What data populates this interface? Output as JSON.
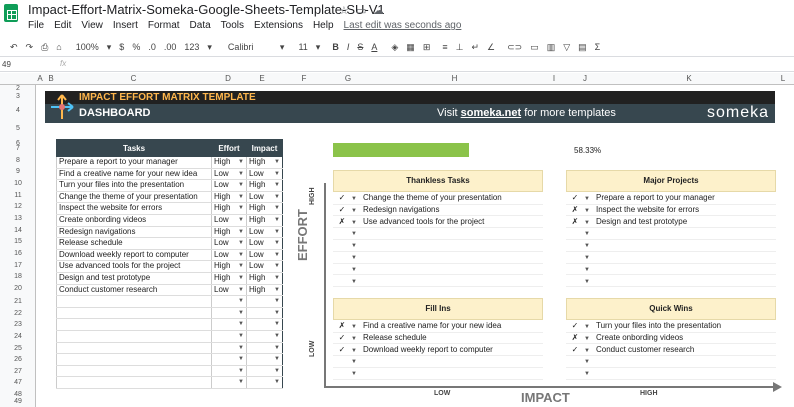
{
  "app": {
    "doc_title": "Impact-Effort-Matrix-Someka-Google-Sheets-Template-SU-V1",
    "menu": [
      "File",
      "Edit",
      "View",
      "Insert",
      "Format",
      "Data",
      "Tools",
      "Extensions",
      "Help"
    ],
    "last_edit": "Last edit was seconds ago"
  },
  "toolbar": {
    "zoom": "100%",
    "currency": "$",
    "percent": "%",
    "dec_less": ".0",
    "dec_more": ".00",
    "num_format": "123",
    "font": "Calibri",
    "font_size": "11",
    "bold": "B",
    "italic": "I",
    "strike": "S",
    "text_color": "A"
  },
  "formula_bar": {
    "cell_ref": "49",
    "fx": "fx"
  },
  "columns": [
    "A",
    "B",
    "C",
    "D",
    "E",
    "F",
    "G",
    "H",
    "I",
    "J",
    "K",
    "L"
  ],
  "rows": [
    "1",
    "2",
    "3",
    "4",
    "5",
    "6",
    "7",
    "8",
    "9",
    "10",
    "11",
    "12",
    "13",
    "14",
    "15",
    "16",
    "17",
    "18",
    "20",
    "21",
    "22",
    "23",
    "24",
    "25",
    "26",
    "27",
    "47",
    "48",
    "49"
  ],
  "header": {
    "template_title": "IMPACT EFFORT MATRIX TEMPLATE",
    "dashboard": "DASHBOARD",
    "visit_prefix": "Visit ",
    "visit_link": "someka.net",
    "visit_suffix": " for more templates",
    "brand": "someka"
  },
  "table": {
    "headers": [
      "Tasks",
      "Effort",
      "Impact"
    ],
    "rows": [
      {
        "task": "Prepare a report to your manager",
        "effort": "High",
        "impact": "High"
      },
      {
        "task": "Find a creative name for your new idea",
        "effort": "Low",
        "impact": "Low"
      },
      {
        "task": "Turn your files into the presentation",
        "effort": "Low",
        "impact": "High"
      },
      {
        "task": "Change the theme of your presentation",
        "effort": "High",
        "impact": "Low"
      },
      {
        "task": "Inspect the website for errors",
        "effort": "High",
        "impact": "High"
      },
      {
        "task": "Create onbording videos",
        "effort": "Low",
        "impact": "High"
      },
      {
        "task": "Redesign navigations",
        "effort": "High",
        "impact": "Low"
      },
      {
        "task": "Release schedule",
        "effort": "Low",
        "impact": "Low"
      },
      {
        "task": "Download weekly report to computer",
        "effort": "Low",
        "impact": "Low"
      },
      {
        "task": "Use advanced tools for the project",
        "effort": "High",
        "impact": "Low"
      },
      {
        "task": "Design and test prototype",
        "effort": "High",
        "impact": "High"
      },
      {
        "task": "Conduct customer research",
        "effort": "Low",
        "impact": "High"
      },
      {
        "task": "",
        "effort": "",
        "impact": ""
      },
      {
        "task": "",
        "effort": "",
        "impact": ""
      },
      {
        "task": "",
        "effort": "",
        "impact": ""
      },
      {
        "task": "",
        "effort": "",
        "impact": ""
      },
      {
        "task": "",
        "effort": "",
        "impact": ""
      },
      {
        "task": "",
        "effort": "",
        "impact": ""
      },
      {
        "task": "",
        "effort": "",
        "impact": ""
      },
      {
        "task": "",
        "effort": "",
        "impact": ""
      }
    ]
  },
  "progress": {
    "fraction": 0.5833,
    "label": "58.33%",
    "color": "#8bc34a"
  },
  "matrix": {
    "effort_label": "EFFORT",
    "impact_label": "IMPACT",
    "high_y": "HIGH",
    "low_y": "LOW",
    "low_x": "LOW",
    "high_x": "HIGH",
    "quadrants": {
      "thankless": {
        "title": "Thankless Tasks",
        "items": [
          {
            "mark": "✓",
            "text": "Change the theme of your presentation"
          },
          {
            "mark": "✓",
            "text": "Redesign navigations"
          },
          {
            "mark": "✗",
            "text": "Use advanced tools for the project"
          },
          {
            "mark": "",
            "text": ""
          },
          {
            "mark": "",
            "text": ""
          },
          {
            "mark": "",
            "text": ""
          },
          {
            "mark": "",
            "text": ""
          },
          {
            "mark": "",
            "text": ""
          }
        ]
      },
      "major": {
        "title": "Major Projects",
        "items": [
          {
            "mark": "✓",
            "text": "Prepare a report to your manager"
          },
          {
            "mark": "✗",
            "text": "Inspect the website for errors"
          },
          {
            "mark": "✗",
            "text": "Design and test prototype"
          },
          {
            "mark": "",
            "text": ""
          },
          {
            "mark": "",
            "text": ""
          },
          {
            "mark": "",
            "text": ""
          },
          {
            "mark": "",
            "text": ""
          },
          {
            "mark": "",
            "text": ""
          }
        ]
      },
      "fillins": {
        "title": "Fill Ins",
        "items": [
          {
            "mark": "✗",
            "text": "Find a creative name for your new idea"
          },
          {
            "mark": "✓",
            "text": "Release schedule"
          },
          {
            "mark": "✓",
            "text": "Download weekly report to computer"
          },
          {
            "mark": "",
            "text": ""
          },
          {
            "mark": "",
            "text": ""
          }
        ]
      },
      "quickwins": {
        "title": "Quick Wins",
        "items": [
          {
            "mark": "✓",
            "text": "Turn your files into the presentation"
          },
          {
            "mark": "✗",
            "text": "Create onbording videos"
          },
          {
            "mark": "✓",
            "text": "Conduct customer research"
          },
          {
            "mark": "",
            "text": ""
          },
          {
            "mark": "",
            "text": ""
          }
        ]
      }
    }
  },
  "colors": {
    "header_dark": "#212121",
    "header_slate": "#37474f",
    "accent_orange": "#ffb74d",
    "quad_fill": "#fdf1cb"
  }
}
